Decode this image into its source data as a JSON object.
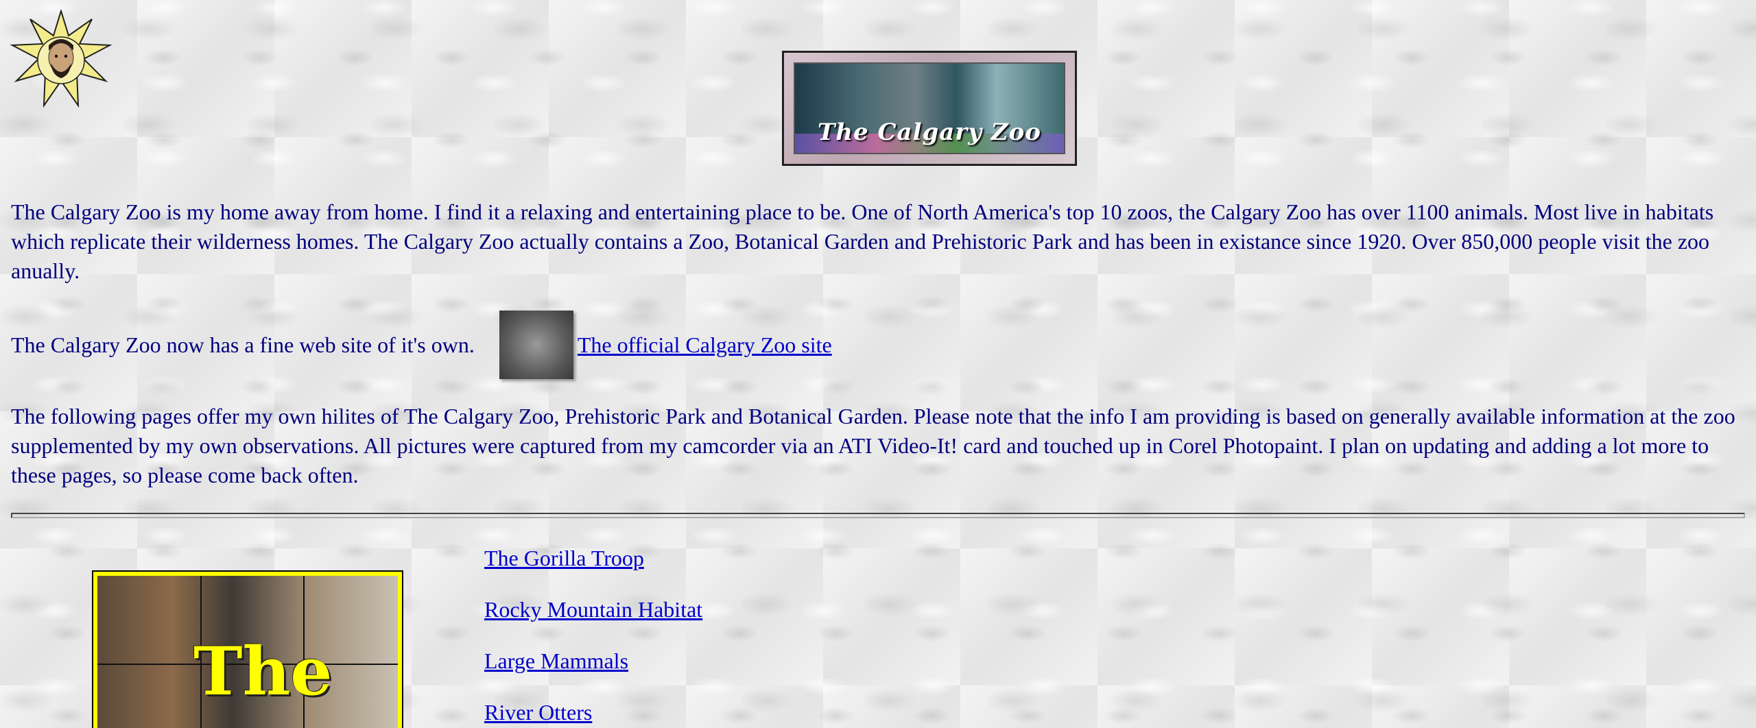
{
  "banner": {
    "title": "The Calgary Zoo"
  },
  "intro": {
    "text": "The Calgary Zoo is my home away from home. I find it a relaxing and entertaining place to be. One of North America's top 10 zoos, the Calgary Zoo has over 1100 animals. Most live in habitats which replicate their wilderness homes. The Calgary Zoo actually contains a Zoo, Botanical Garden and Prehistoric Park and has been in existance since 1920. Over 850,000 people visit the zoo anually."
  },
  "official": {
    "text": "The Calgary Zoo now has a fine web site of it's own.",
    "link": "The official Calgary Zoo site"
  },
  "hilites": {
    "text": "The following pages offer my own hilites of The Calgary Zoo, Prehistoric Park and Botanical Garden. Please note that the info I am providing is based on generally available information at the zoo supplemented by my own observations. All pictures were captured from my camcorder via an ATI Video-It! card and touched up in Corel Photopaint. I plan on updating and adding a lot more to these pages, so please come back often."
  },
  "collage": {
    "word": "The"
  },
  "nav": {
    "links": [
      {
        "label": "The Gorilla Troop"
      },
      {
        "label": "Rocky Mountain Habitat"
      },
      {
        "label": "Large Mammals"
      },
      {
        "label": "River Otters"
      }
    ]
  },
  "colors": {
    "text": "#000080",
    "link": "#0000cc",
    "collage_border": "#ffff00"
  }
}
